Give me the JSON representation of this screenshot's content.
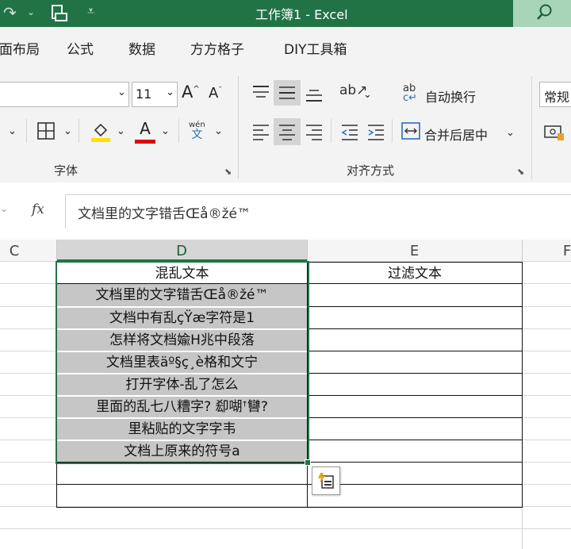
{
  "titlebar": {
    "title": "工作簿1  -  Excel"
  },
  "menu": {
    "items": [
      "页面布局",
      "公式",
      "数据",
      "方方格子",
      "DIY工具箱"
    ]
  },
  "ribbon": {
    "font_size": "11",
    "font_group_label": "字体",
    "align_group_label": "对齐方式",
    "wrap_text": "自动换行",
    "merge_center": "合并后居中",
    "number_format": "常规"
  },
  "formula_bar": {
    "fx": "fx",
    "content": "文档里的文字错舌Œå®žé™"
  },
  "columns": {
    "c": "C",
    "d": "D",
    "e": "E",
    "f": "F"
  },
  "sheet": {
    "header_d": "混乱文本",
    "header_e": "过滤文本",
    "rows": [
      "文档里的文字错舌Œå®žé™",
      "文档中有乱çŸæ字符是1",
      "怎样将文档婾H兆中段落",
      "文档里表äº§ç¸è格和文宁",
      "打开字体-乱了怎么",
      "里面的乱七八糟字?   㕁㗅ꜛ㘜? ",
      "里粘贴的文字字韦",
      "文档上原来的符号a"
    ]
  },
  "colors": {
    "accent": "#217346",
    "selection": "#c6c6c6"
  }
}
